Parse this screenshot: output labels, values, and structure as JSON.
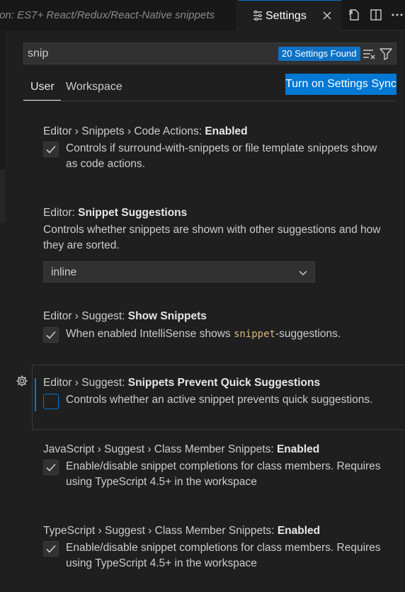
{
  "tabs": {
    "inactive_label": "on: ES7+ React/Redux/React-Native snippets",
    "active_label": "Settings"
  },
  "search": {
    "value": "snip",
    "found_badge": "20 Settings Found"
  },
  "scope_tabs": {
    "user": "User",
    "workspace": "Workspace"
  },
  "sync_button": "Turn on Settings Sync",
  "settings": [
    {
      "category": "Editor › Snippets › Code Actions: ",
      "key": "Enabled",
      "checked": true,
      "desc_line1": "Controls if surround-with-snippets or file template snippets show",
      "desc_line2": "as code actions."
    },
    {
      "category": "Editor: ",
      "key": "Snippet Suggestions",
      "desc_line1": "Controls whether snippets are shown with other suggestions and how",
      "desc_line2": "they are sorted.",
      "select_value": "inline"
    },
    {
      "category": "Editor › Suggest: ",
      "key": "Show Snippets",
      "checked": true,
      "desc_before": "When enabled IntelliSense shows ",
      "desc_code": "snippet",
      "desc_after": "-suggestions."
    },
    {
      "category": "Editor › Suggest: ",
      "key": "Snippets Prevent Quick Suggestions",
      "checked": false,
      "desc_line1": "Controls whether an active snippet prevents quick suggestions."
    },
    {
      "category": "JavaScript › Suggest › Class Member Snippets: ",
      "key": "Enabled",
      "checked": true,
      "desc_line1": "Enable/disable snippet completions for class members. Requires",
      "desc_line2": "using TypeScript 4.5+ in the workspace"
    },
    {
      "category": "TypeScript › Suggest › Class Member Snippets: ",
      "key": "Enabled",
      "checked": true,
      "desc_line1": "Enable/disable snippet completions for class members. Requires",
      "desc_line2": "using TypeScript 4.5+ in the workspace"
    }
  ],
  "icons": {
    "tab": "settings-file-icon",
    "close": "close-icon",
    "open_json": "open-settings-json-icon",
    "split": "split-editor-icon",
    "more": "more-actions-icon",
    "clear": "clear-filter-icon",
    "filter": "filter-icon",
    "gear": "gear-icon",
    "chevron": "chevron-down-icon"
  },
  "colors": {
    "accent": "#0078d4",
    "badge": "#0e72c4",
    "code": "#d7ba7d"
  }
}
